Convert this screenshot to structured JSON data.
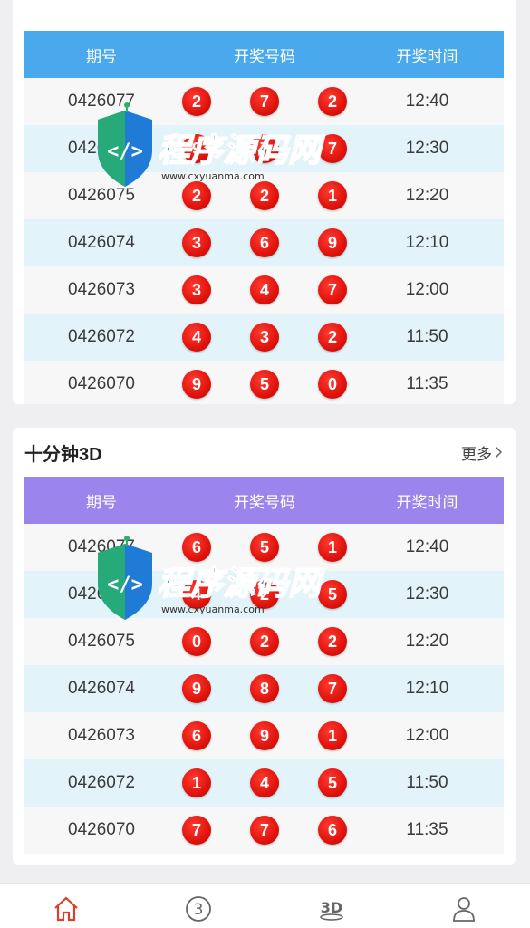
{
  "colors": {
    "header_blue": "#4aa9ec",
    "header_purple": "#9b84ec",
    "ball_red": "#e0130d",
    "row_alt": "#e2f3fa",
    "active_tab": "#d9402b"
  },
  "table_headers": {
    "issue": "期号",
    "numbers": "开奖号码",
    "time": "开奖时间"
  },
  "section1": {
    "rows": [
      {
        "issue": "0426077",
        "n1": "2",
        "n2": "7",
        "n3": "2",
        "time": "12:40"
      },
      {
        "issue": "0426076",
        "n1": "9",
        "n2": "7",
        "n3": "7",
        "time": "12:30"
      },
      {
        "issue": "0426075",
        "n1": "2",
        "n2": "2",
        "n3": "1",
        "time": "12:20"
      },
      {
        "issue": "0426074",
        "n1": "3",
        "n2": "6",
        "n3": "9",
        "time": "12:10"
      },
      {
        "issue": "0426073",
        "n1": "3",
        "n2": "4",
        "n3": "7",
        "time": "12:00"
      },
      {
        "issue": "0426072",
        "n1": "4",
        "n2": "3",
        "n3": "2",
        "time": "11:50"
      },
      {
        "issue": "0426070",
        "n1": "9",
        "n2": "5",
        "n3": "0",
        "time": "11:35"
      }
    ]
  },
  "section2": {
    "title": "十分钟3D",
    "more": "更多",
    "rows": [
      {
        "issue": "0426077",
        "n1": "6",
        "n2": "5",
        "n3": "1",
        "time": "12:40"
      },
      {
        "issue": "0426076",
        "n1": "4",
        "n2": "2",
        "n3": "5",
        "time": "12:30"
      },
      {
        "issue": "0426075",
        "n1": "0",
        "n2": "2",
        "n3": "2",
        "time": "12:20"
      },
      {
        "issue": "0426074",
        "n1": "9",
        "n2": "8",
        "n3": "7",
        "time": "12:10"
      },
      {
        "issue": "0426073",
        "n1": "6",
        "n2": "9",
        "n3": "1",
        "time": "12:00"
      },
      {
        "issue": "0426072",
        "n1": "1",
        "n2": "4",
        "n3": "5",
        "time": "11:50"
      },
      {
        "issue": "0426070",
        "n1": "7",
        "n2": "7",
        "n3": "6",
        "time": "11:35"
      }
    ]
  },
  "watermark": {
    "brand": "程序源码网",
    "url": "www.cxyuanma.com"
  },
  "tabbar": {
    "tab3d_icon_text": "3D"
  }
}
